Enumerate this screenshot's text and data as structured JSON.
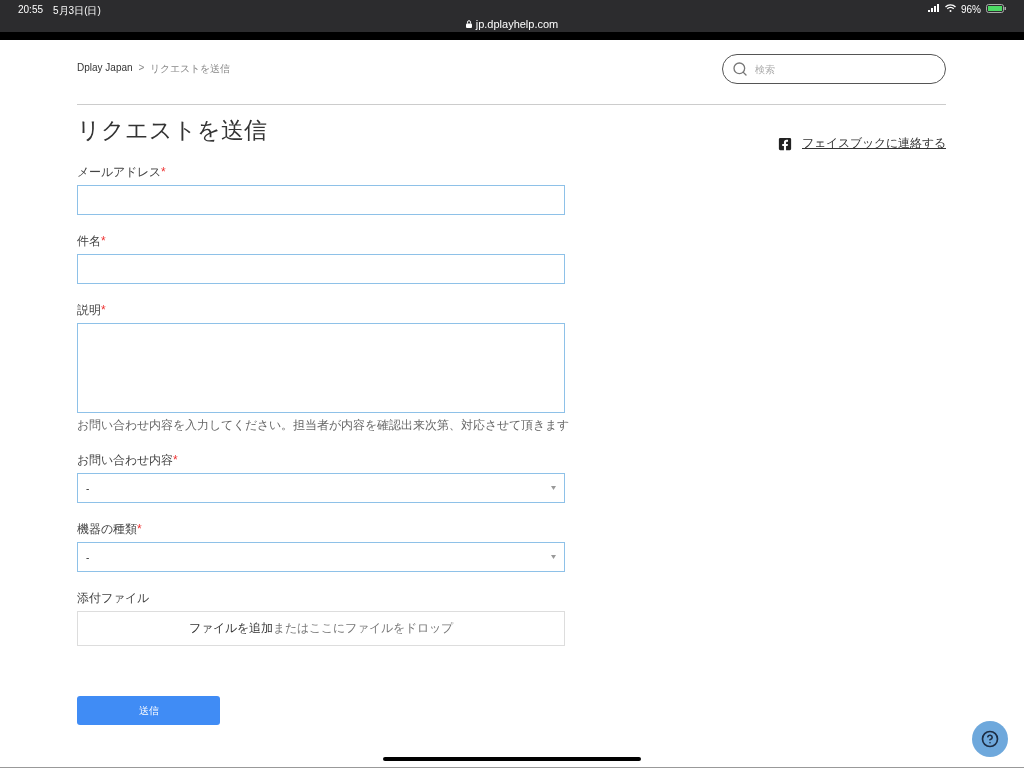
{
  "status_bar": {
    "time": "20:55",
    "date": "5月3日(日)",
    "url": "jp.dplayhelp.com",
    "battery": "96%"
  },
  "breadcrumb": [
    {
      "label": "Dplay Japan",
      "selected": false
    },
    {
      "label": "リクエストを送信",
      "selected": true
    }
  ],
  "breadcrumb_separator": ">",
  "search": {
    "placeholder": "検索"
  },
  "title": "リクエストを送信",
  "facebook_link": "フェイスブックに連絡する",
  "fields": [
    {
      "kind": "input",
      "label": "メールアドレス",
      "required_mark": "*"
    },
    {
      "kind": "input",
      "label": "件名",
      "required_mark": "*"
    },
    {
      "kind": "textarea",
      "label": "説明",
      "required_mark": "*",
      "hint": "お問い合わせ内容を入力してください。担当者が内容を確認出来次第、対応させて頂きます"
    },
    {
      "kind": "select",
      "label": "お問い合わせ内容",
      "required_mark": "*",
      "value": "-"
    },
    {
      "kind": "select",
      "label": "機器の種類",
      "required_mark": "*",
      "value": "-"
    },
    {
      "kind": "file",
      "label": "添付ファイル",
      "text": "**ファイルを追加**またはここにファイルをドロップ"
    }
  ],
  "submit": "送信"
}
